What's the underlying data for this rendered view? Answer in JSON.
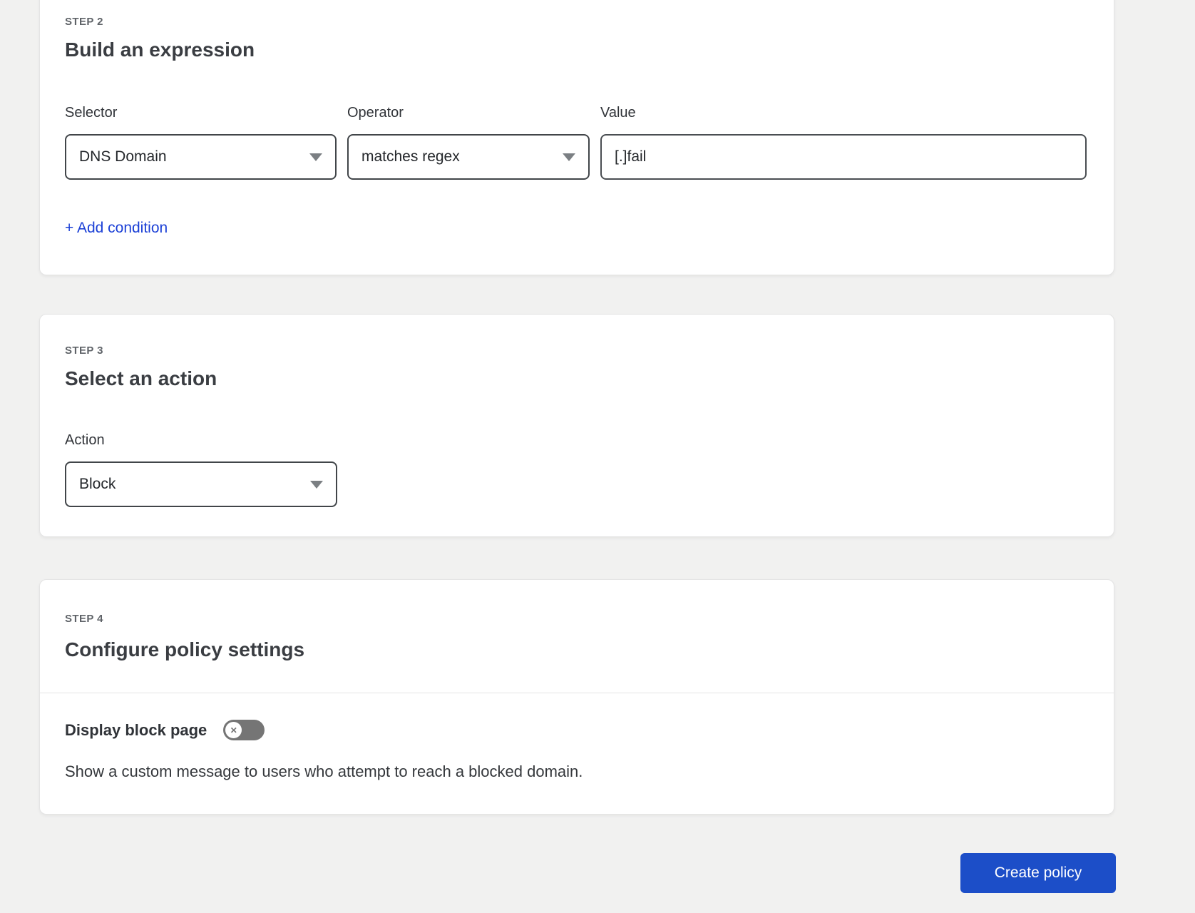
{
  "colors": {
    "page_background": "#f1f1f0",
    "card_background": "#ffffff",
    "accent_button_blue": "#1c4ec8",
    "link_blue": "#1a3fd6",
    "toggle_off_gray": "#757575"
  },
  "step2": {
    "step_label": "STEP 2",
    "title": "Build an expression",
    "fields": {
      "selector": {
        "label": "Selector",
        "value": "DNS Domain"
      },
      "operator": {
        "label": "Operator",
        "value": "matches regex"
      },
      "value": {
        "label": "Value",
        "value": "[.]fail"
      }
    },
    "add_condition_label": "+ Add condition"
  },
  "step3": {
    "step_label": "STEP 3",
    "title": "Select an action",
    "action": {
      "label": "Action",
      "value": "Block"
    }
  },
  "step4": {
    "step_label": "STEP 4",
    "title": "Configure policy settings",
    "display_block_page": {
      "label": "Display block page",
      "toggle_state": "off",
      "toggle_glyph": "✕",
      "description": "Show a custom message to users who attempt to reach a blocked domain."
    }
  },
  "footer": {
    "create_policy_label": "Create policy"
  }
}
